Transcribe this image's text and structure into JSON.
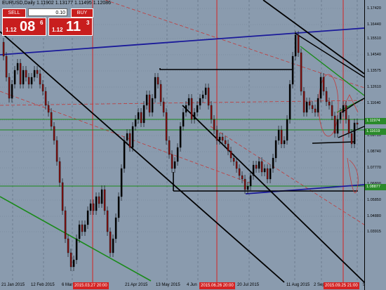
{
  "window": {
    "title": "EURUSD,Daily  1.11902 1.13177 1.11495 1.12086"
  },
  "trade_panel": {
    "sell_label": "SELL",
    "buy_label": "BUY",
    "lot": "0.10",
    "sell_price": {
      "prefix": "1.12",
      "big": "08",
      "sup": "6"
    },
    "buy_price": {
      "prefix": "1.12",
      "big": "11",
      "sup": "3"
    }
  },
  "y_axis": {
    "labels": [
      "1.17420",
      "1.16440",
      "1.15510",
      "1.14540",
      "1.13575",
      "1.12610",
      "1.11640",
      "1.10650",
      "1.09710",
      "1.08740",
      "1.07770",
      "1.06800",
      "1.05850",
      "1.04880",
      "1.03915"
    ],
    "badges": [
      {
        "text": "1.11974",
        "color": "#2a8a2a"
      },
      {
        "text": "1.11619",
        "color": "#2a8a2a"
      },
      {
        "text": "1.08877",
        "color": "#2a8a2a"
      }
    ]
  },
  "x_axis": {
    "labels": [
      "21 Jan 2015",
      "12 Feb 2015",
      "6 Mar 2",
      "21 Apr 2015",
      "13 May 2015",
      "4 Jun",
      "20 Jul 2015",
      "11 Aug 2015",
      "2 Sep",
      "5"
    ],
    "badges": [
      "2015.03.27 20:00",
      "2015.06.26 20:00",
      "2015.09.25 21:00"
    ]
  },
  "colors": {
    "background": "#8a9bae",
    "bull": "#000000",
    "bear": "#7a1010",
    "blue_line": "#1a1a9a",
    "green_line": "#1a8a1a",
    "red_line": "#d42323"
  }
}
